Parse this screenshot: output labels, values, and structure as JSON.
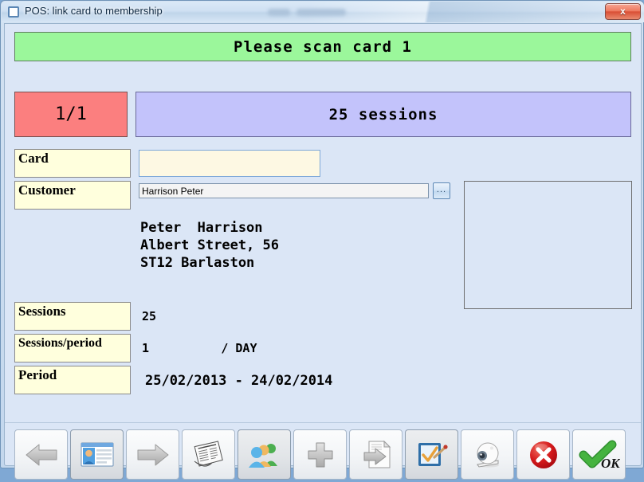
{
  "window": {
    "title": "POS: link card to membership",
    "icon": "window-icon",
    "close_label": "x"
  },
  "banner": {
    "message": "Please scan card 1"
  },
  "summary": {
    "counter": "1/1",
    "sessions_text": "25 sessions"
  },
  "form": {
    "card": {
      "label": "Card",
      "value": "",
      "placeholder": ""
    },
    "customer": {
      "label": "Customer",
      "value": "Harrison Peter",
      "browse_label": "..."
    },
    "address": "Peter  Harrison\nAlbert Street, 56\nST12 Barlaston",
    "sessions": {
      "label": "Sessions",
      "value": "25"
    },
    "sessions_per_period": {
      "label": "Sessions/period",
      "value": "1          / DAY"
    },
    "period": {
      "label": "Period",
      "value": "25/02/2013 - 24/02/2014"
    }
  },
  "colors": {
    "banner_green": "#9bf79b",
    "counter_red": "#fb7f7f",
    "sessions_purple": "#c3c3fb",
    "label_yellow": "#ffffdd",
    "form_background": "#dbe6f6",
    "card_input_cream": "#fdf8e3"
  },
  "toolbar": {
    "buttons": [
      {
        "name": "previous-button",
        "icon": "arrow-left-icon"
      },
      {
        "name": "customer-card-button",
        "icon": "id-card-icon"
      },
      {
        "name": "next-button",
        "icon": "arrow-right-icon"
      },
      {
        "name": "documents-button",
        "icon": "newspaper-icon"
      },
      {
        "name": "members-button",
        "icon": "people-group-icon"
      },
      {
        "name": "add-button",
        "icon": "plus-icon"
      },
      {
        "name": "export-button",
        "icon": "document-arrow-icon"
      },
      {
        "name": "form-edit-button",
        "icon": "clipboard-check-pen-icon"
      },
      {
        "name": "webcam-button",
        "icon": "webcam-icon"
      },
      {
        "name": "cancel-button",
        "icon": "red-x-icon"
      },
      {
        "name": "ok-button",
        "icon": "green-check-ok-icon",
        "label": "OK"
      }
    ]
  }
}
